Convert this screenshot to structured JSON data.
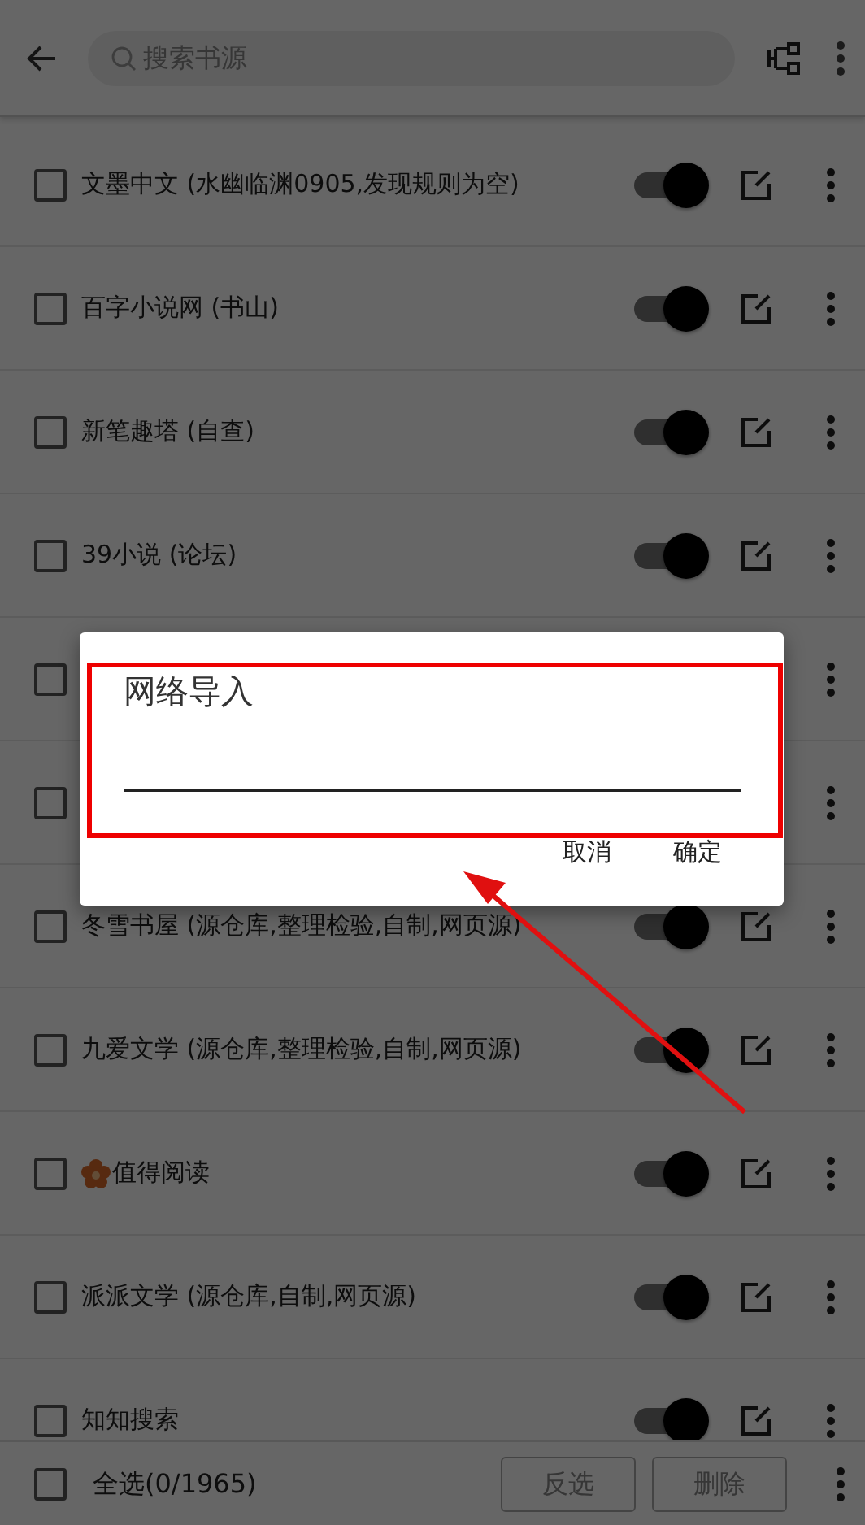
{
  "toolbar": {
    "search": {
      "placeholder": "搜索书源"
    }
  },
  "sources": [
    {
      "name": "文墨中文 (水幽临渊0905,发现规则为空)",
      "checked": false,
      "on": true
    },
    {
      "name": "百字小说网 (书山)",
      "checked": false,
      "on": true
    },
    {
      "name": "新笔趣塔 (自查)",
      "checked": false,
      "on": true
    },
    {
      "name": "39小说 (论坛)",
      "checked": false,
      "on": true
    },
    {
      "checked": false
    },
    {
      "checked": false
    },
    {
      "name": "冬雪书屋 (源仓库,整理检验,自制,网页源)",
      "checked": false,
      "on": true
    },
    {
      "name": "九爱文学 (源仓库,整理检验,自制,网页源)",
      "checked": false,
      "on": true
    },
    {
      "name": "值得阅读",
      "checked": false,
      "on": true,
      "flower": true
    },
    {
      "name": "派派文学 (源仓库,自制,网页源)",
      "checked": false,
      "on": true
    },
    {
      "name": "知知搜索",
      "checked": false,
      "on": true
    }
  ],
  "bottom_bar": {
    "select_all": {
      "label": "全选(0/1965)",
      "checked": false
    },
    "buttons": [
      {
        "label": "反选",
        "disabled": true
      },
      {
        "label": "删除",
        "disabled": true
      }
    ]
  },
  "dialog": {
    "title": "网络导入",
    "buttons": [
      {
        "label": "取消"
      },
      {
        "label": "确定"
      }
    ]
  }
}
